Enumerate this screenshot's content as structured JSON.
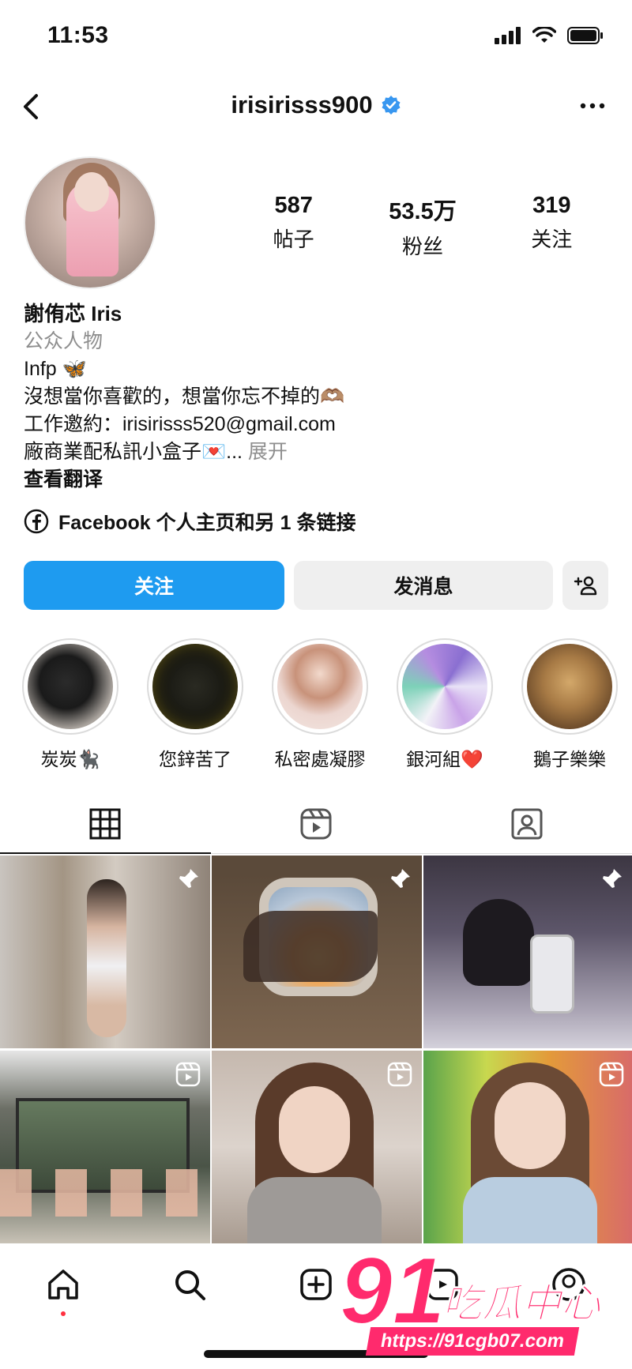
{
  "status": {
    "time": "11:53"
  },
  "header": {
    "username": "irisirisss900"
  },
  "profile": {
    "stats": [
      {
        "value": "587",
        "label": "帖子"
      },
      {
        "value": "53.5万",
        "label": "粉丝"
      },
      {
        "value": "319",
        "label": "关注"
      }
    ],
    "name": "謝侑芯 Iris",
    "category": "公众人物",
    "bio_lines": [
      "Infp 🦋",
      "沒想當你喜歡的，想當你忘不掉的🫶🏽",
      "工作邀約：irisirisss520@gmail.com"
    ],
    "bio_last": "廠商業配私訊小盒子💌...",
    "more": "展开",
    "translate": "查看翻译",
    "link_text": "Facebook 个人主页和另 1 条链接"
  },
  "buttons": {
    "follow": "关注",
    "message": "发消息"
  },
  "highlights": [
    {
      "label": "炭炭🐈‍⬛"
    },
    {
      "label": "您鋅苦了"
    },
    {
      "label": "私密處凝膠"
    },
    {
      "label": "銀河組❤️"
    },
    {
      "label": "鵝子樂樂"
    }
  ],
  "watermark": {
    "number": "91",
    "text": "吃瓜中心",
    "url": "https://91cgb07.com"
  },
  "colors": {
    "accent": "#1e9bf0",
    "verified": "#3897f0",
    "watermark": "#ff2a6d"
  }
}
